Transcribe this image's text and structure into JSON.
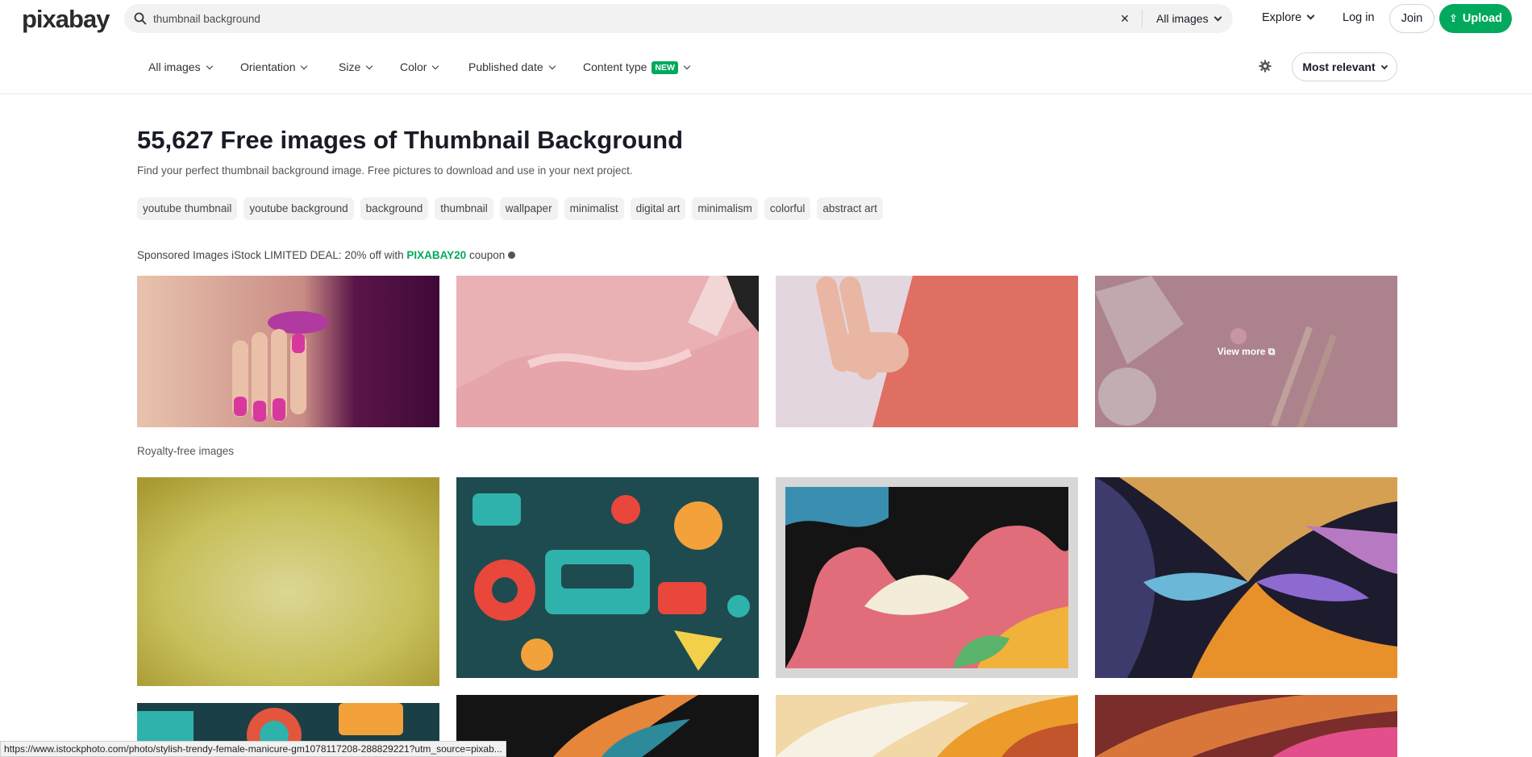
{
  "brand": {
    "logo_text": "pixabay"
  },
  "search": {
    "value": "thumbnail background",
    "clear_symbol": "×",
    "scope_label": "All images"
  },
  "nav": {
    "explore": "Explore",
    "login": "Log in",
    "join": "Join",
    "upload": "Upload"
  },
  "filters": {
    "items": [
      "All images",
      "Orientation",
      "Size",
      "Color",
      "Published date",
      "Content type"
    ],
    "new_badge": "NEW",
    "sort_label": "Most relevant"
  },
  "header": {
    "title": "55,627 Free images of Thumbnail Background",
    "description": "Find your perfect thumbnail background image. Free pictures to download and use in your next project."
  },
  "tags": [
    "youtube thumbnail",
    "youtube background",
    "background",
    "thumbnail",
    "wallpaper",
    "minimalist",
    "digital art",
    "minimalism",
    "colorful",
    "abstract art"
  ],
  "sponsored": {
    "prefix": "Sponsored Images iStock LIMITED DEAL: 20% off with ",
    "code": "PIXABAY20",
    "suffix": " coupon",
    "view_more": "View more"
  },
  "royalty_label": "Royalty-free images",
  "status_url": "https://www.istockphoto.com/photo/stylish-trendy-female-manicure-gm1078117208-288829221?utm_source=pixab...",
  "colors": {
    "accent": "#00a95c",
    "text": "#191b26"
  }
}
